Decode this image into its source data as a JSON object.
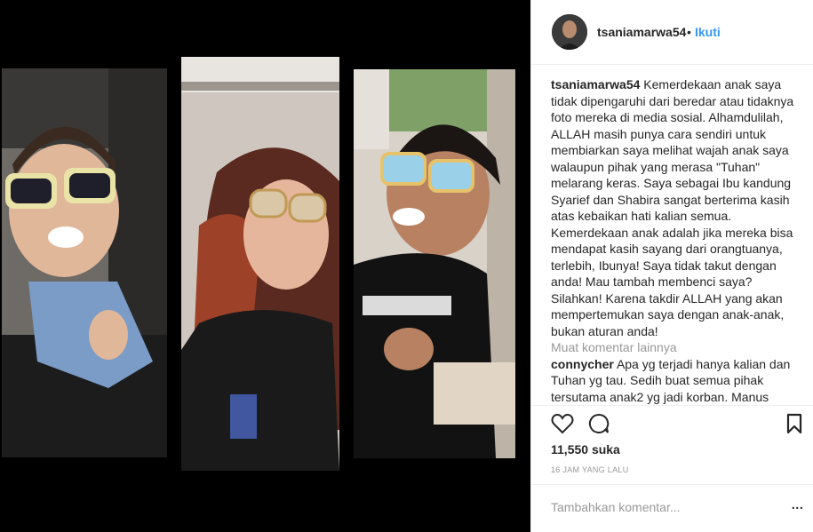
{
  "post": {
    "username": "tsaniamarwa54",
    "follow_label": "Ikuti",
    "separator": "•"
  },
  "photos": [
    {
      "icon": "child-sunglasses-photo"
    },
    {
      "icon": "woman-sunglasses-photo"
    },
    {
      "icon": "boy-sunglasses-photo"
    }
  ],
  "comments": {
    "caption": {
      "user": "tsaniamarwa54",
      "text": "Kemerdekaan anak saya tidak dipengaruhi dari beredar atau tidaknya foto mereka di media sosial. Alhamdulilah, ALLAH masih punya cara sendiri untuk membiarkan saya melihat wajah anak saya walaupun pihak yang merasa \"Tuhan\" melarang keras. Saya sebagai Ibu kandung Syarief dan Shabira sangat berterima kasih atas kebaikan hati kalian semua. Kemerdekaan anak adalah jika mereka bisa mendapat kasih sayang dari orangtuanya, terlebih, Ibunya! Saya tidak takut dengan anda! Mau tambah membenci saya? Silahkan! Karena takdir ALLAH yang akan mempertemukan saya dengan anak-anak, bukan aturan anda!"
    },
    "load_more": "Muat komentar lainnya",
    "second": {
      "user": "connycher",
      "text": "Apa yg terjadi hanya kalian dan Tuhan yg tau. Sedih buat semua pihak tersutama anak2 yg jadi korban. Manus"
    }
  },
  "likes": "11,550 suka",
  "timestamp": "16 JAM YANG LALU",
  "comment_input": {
    "placeholder": "Tambahkan komentar..."
  },
  "more_options": "...",
  "icons": {
    "heart": "heart-icon",
    "comment": "comment-icon",
    "bookmark": "bookmark-icon"
  }
}
